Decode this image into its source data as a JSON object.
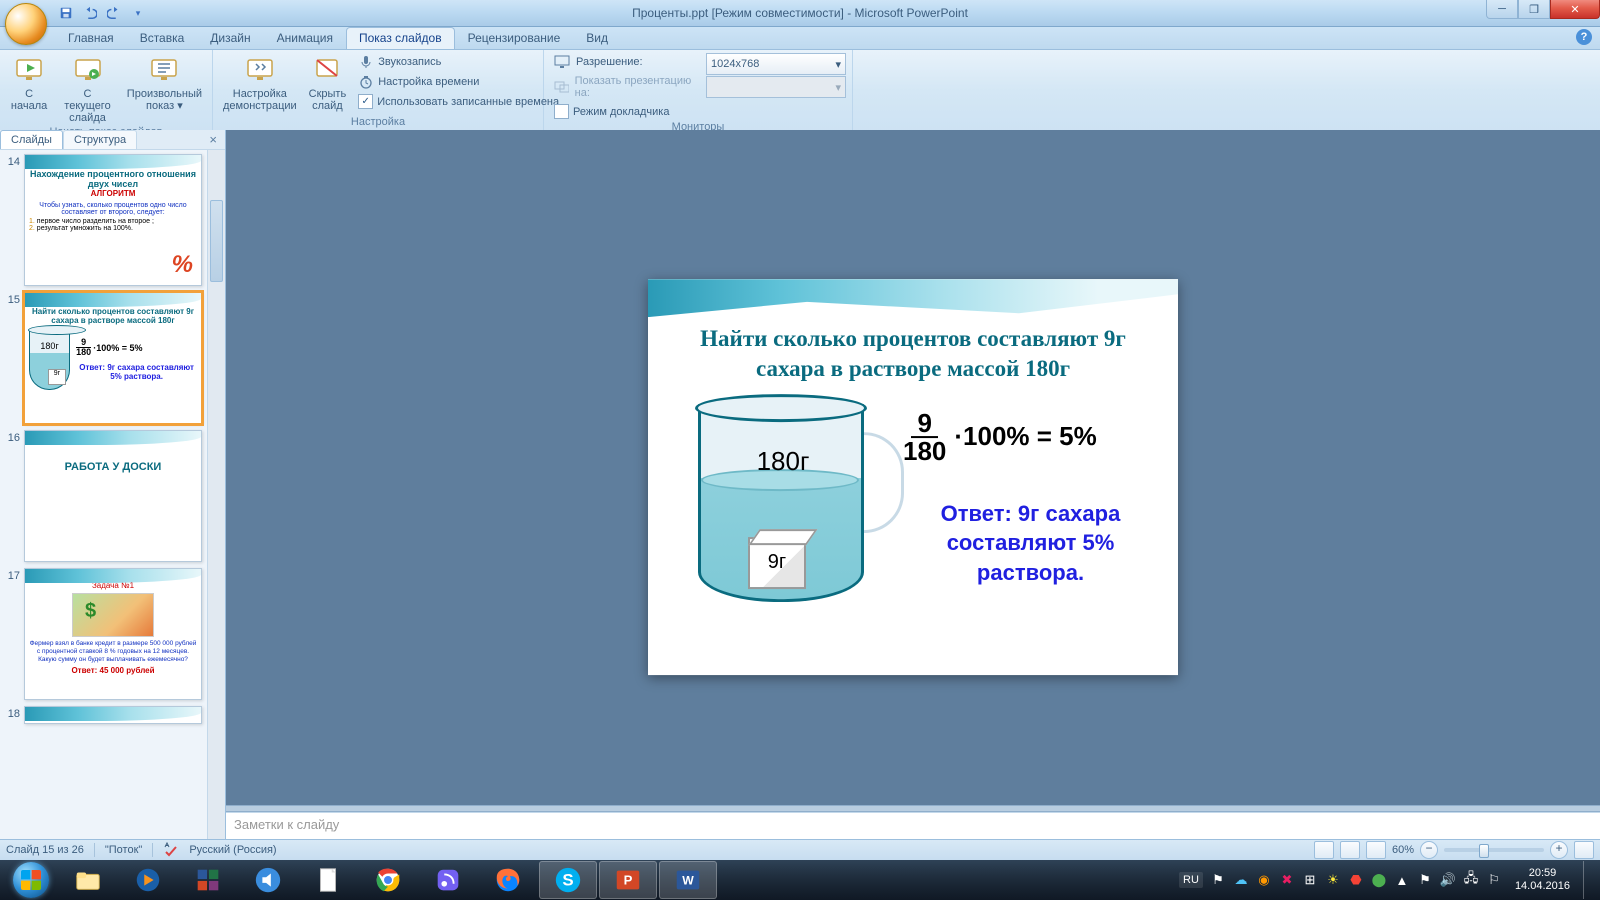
{
  "window": {
    "title": "Проценты.ppt [Режим совместимости] - Microsoft PowerPoint"
  },
  "ribbon": {
    "tabs": [
      "Главная",
      "Вставка",
      "Дизайн",
      "Анимация",
      "Показ слайдов",
      "Рецензирование",
      "Вид"
    ],
    "active_tab": "Показ слайдов",
    "groups": {
      "start": {
        "label": "Начать показ слайдов",
        "from_start": "С начала",
        "from_current": "С текущего слайда",
        "custom": "Произвольный показ ▾"
      },
      "setup": {
        "label": "Настройка",
        "setup_show": "Настройка демонстрации",
        "hide": "Скрыть слайд",
        "record": "Звукозапись",
        "rehearse": "Настройка времени",
        "use_timings": "Использовать записанные времена"
      },
      "monitors": {
        "label": "Мониторы",
        "resolution_lbl": "Разрешение:",
        "resolution_val": "1024x768",
        "show_on_lbl": "Показать презентацию на:",
        "presenter": "Режим докладчика"
      }
    }
  },
  "sidepane": {
    "tabs": [
      "Слайды",
      "Структура"
    ],
    "thumbs": [
      {
        "num": "14",
        "title": "Нахождение процентного отношения двух чисел",
        "sub": "АЛГОРИТМ",
        "body": "Чтобы узнать, сколько процентов одно число составляет от второго, следует:",
        "li1": "первое число разделить на второе ;",
        "li2": "результат умножить на 100%."
      },
      {
        "num": "15",
        "title": "Найти сколько процентов составляют 9г сахара в растворе массой 180г",
        "mass": "180г",
        "sugar": "9г",
        "frac_n": "9",
        "frac_d": "180",
        "rest": "·100% = 5%",
        "answer": "Ответ: 9г сахара составляют 5% раствора."
      },
      {
        "num": "16",
        "title": "РАБОТА У ДОСКИ"
      },
      {
        "num": "17",
        "title": "Задача №1",
        "body": "Фермер взял в банке кредит в размере 500 000 рублей с процентной ставкой 8 % годовых на 12 месяцев. Какую сумму он будет выплачивать ежемесячно?",
        "answer": "Ответ:  45 000 рублей"
      },
      {
        "num": "18"
      }
    ]
  },
  "slide": {
    "title": "Найти сколько процентов составляют 9г сахара в растворе массой 180г",
    "mass": "180г",
    "sugar": "9г",
    "frac_n": "9",
    "frac_d": "180",
    "rest": "·100% = 5%",
    "answer": "Ответ: 9г сахара составляют 5% раствора."
  },
  "notes_placeholder": "Заметки к слайду",
  "status": {
    "slide": "Слайд 15 из 26",
    "theme": "\"Поток\"",
    "lang": "Русский (Россия)",
    "zoom": "60%"
  },
  "taskbar": {
    "lang": "RU",
    "time": "20:59",
    "date": "14.04.2016"
  }
}
